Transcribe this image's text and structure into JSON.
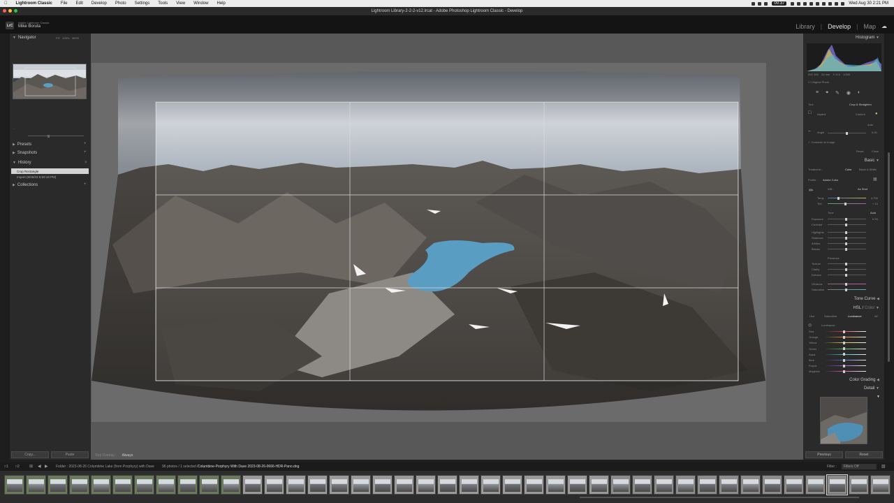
{
  "menubar": {
    "app_name": "Lightroom Classic",
    "items": [
      "File",
      "Edit",
      "Develop",
      "Photo",
      "Settings",
      "Tools",
      "View",
      "Window",
      "Help"
    ],
    "timer": "00:37",
    "clock": "Wed Aug 30  2:21 PM"
  },
  "window": {
    "title": "Lightroom Library-2-2-2-v12.lrcat - Adobe Photoshop Lightroom Classic - Develop"
  },
  "identity": {
    "app_small": "Adobe Lightroom Classic",
    "user": "Mike Boruta",
    "modules": [
      "Library",
      "Develop",
      "Map"
    ],
    "active_module": "Develop"
  },
  "left_panel": {
    "navigator_label": "Navigator",
    "presets_label": "Presets",
    "snapshots_label": "Snapshots",
    "history_label": "History",
    "history_items": [
      "Crop Rectangle",
      "Import (8/26/23 5:50:18 PM)"
    ],
    "collections_label": "Collections",
    "copy_label": "Copy...",
    "paste_label": "Paste"
  },
  "center": {
    "tool_overlay_label": "Tool Overlay :",
    "tool_overlay_value": "Always"
  },
  "right_panel": {
    "histogram_label": "Histogram",
    "original_photo_label": "Original Photo",
    "tool_label": "Tool",
    "crop_label": "Crop & Straighten",
    "aspect_label": "Aspect",
    "aspect_value": "Custom",
    "auto_label": "Auto",
    "angle_label": "Angle",
    "angle_value": "0.00",
    "constrain_label": "Constrain to Image",
    "reset_label": "Reset",
    "close_label": "Close",
    "basic_label": "Basic",
    "treatment_label": "Treatment :",
    "color_label": "Color",
    "bw_label": "Black & White",
    "profile_label": "Profile :",
    "profile_value": "Adobe Color",
    "wb_label": "WB :",
    "wb_value": "As Shot",
    "temp_label": "Temp",
    "temp_value": "4,750",
    "tint_label": "Tint",
    "tint_value": "+ 13",
    "tone_label": "Tone",
    "tone_auto": "Auto",
    "exposure_label": "Exposure",
    "exposure_value": "0.33",
    "contrast_label": "Contrast",
    "highlights_label": "Highlights",
    "shadows_label": "Shadows",
    "whites_label": "Whites",
    "blacks_label": "Blacks",
    "presence_label": "Presence",
    "texture_label": "Texture",
    "clarity_label": "Clarity",
    "dehaze_label": "Dehaze",
    "vibrance_label": "Vibrance",
    "saturation_label": "Saturation",
    "tone_curve_label": "Tone Curve",
    "hsl_label": "HSL",
    "hsl_color_label": "Color",
    "hsl_tabs": [
      "Hue",
      "Saturation",
      "Luminance",
      "All"
    ],
    "luminance_label": "Luminance",
    "hsl_colors": [
      "Red",
      "Orange",
      "Yellow",
      "Green",
      "Aqua",
      "Blue",
      "Purple",
      "Magenta"
    ],
    "color_grading_label": "Color Grading",
    "detail_label": "Detail",
    "previous_label": "Previous",
    "reset_btn_label": "Reset"
  },
  "filmstrip": {
    "folder_text": "Folder : 2023-08-26 Columbine Lake (from Porphyry) with Dave",
    "count_text": "96 photos / 1 selected /",
    "filename": "Columbine-Porphyry With Dave 2023-08-26-0666-HDR-Pano.dng",
    "filter_label": "Filter :",
    "filter_value": "Filters Off",
    "thumb_count": 41,
    "selected_index": 38
  },
  "colors": {
    "accent": "#e6e6e6",
    "panel": "#2a2a2a",
    "canvas": "#585858",
    "green_flag": "#6b7a5a"
  }
}
